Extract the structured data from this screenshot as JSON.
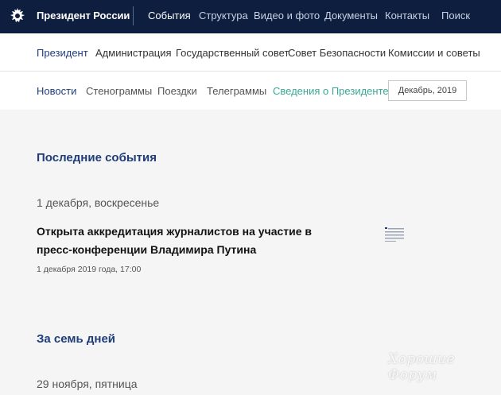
{
  "header": {
    "brand": "Президент России",
    "nav": [
      "События",
      "Структура",
      "Видео и фото",
      "Документы",
      "Контакты",
      "Поиск"
    ]
  },
  "section_nav": [
    "Президент",
    "Администрация",
    "Государственный совет",
    "Совет Безопасности",
    "Комиссии и советы"
  ],
  "sub_nav": [
    "Новости",
    "Стенограммы",
    "Поездки",
    "Телеграммы",
    "Сведения о Президенте"
  ],
  "date_filter": "Декабрь, 2019",
  "content": {
    "latest_title": "Последние события",
    "day1": "1 декабря, воскресенье",
    "headline": "Открыта аккредитация журналистов на участие в пресс-конференции Владимира Путина",
    "stamp": "1 декабря 2019 года, 17:00",
    "week_title": "За семь дней",
    "day2": "29 ноября, пятница"
  },
  "watermark": "Хорошие Форум",
  "colors": {
    "topbar": "#0d1e3f",
    "accent": "#1f3d7a",
    "green": "#3aa896"
  }
}
